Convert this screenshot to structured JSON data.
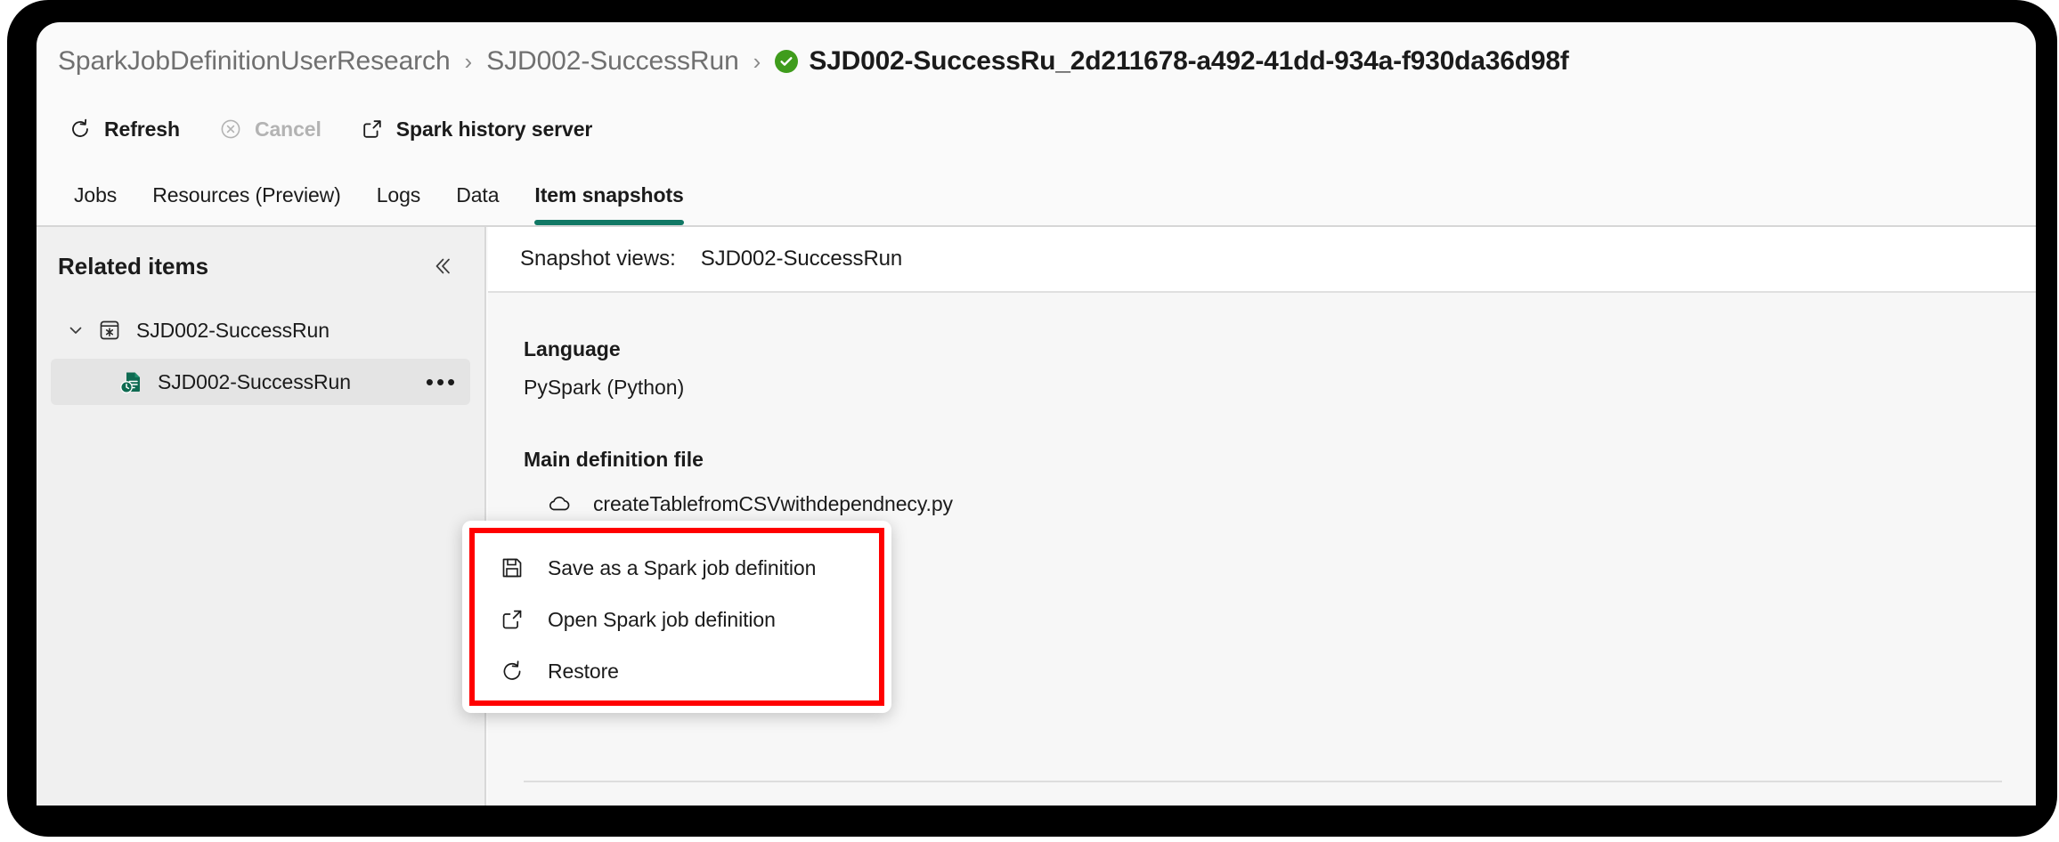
{
  "breadcrumb": {
    "items": [
      {
        "label": "SparkJobDefinitionUserResearch",
        "current": false
      },
      {
        "label": "SJD002-SuccessRun",
        "current": false
      },
      {
        "label": "SJD002-SuccessRu_2d211678-a492-41dd-934a-f930da36d98f",
        "current": true
      }
    ],
    "separator": "›",
    "status_icon": "success-check-icon",
    "status_color": "#3f9c1c"
  },
  "toolbar": {
    "refresh_label": "Refresh",
    "cancel_label": "Cancel",
    "spark_history_label": "Spark history server"
  },
  "tabs": [
    {
      "label": "Jobs",
      "active": false
    },
    {
      "label": "Resources (Preview)",
      "active": false
    },
    {
      "label": "Logs",
      "active": false
    },
    {
      "label": "Data",
      "active": false
    },
    {
      "label": "Item snapshots",
      "active": true
    }
  ],
  "tab_accent_color": "#117865",
  "sidebar": {
    "title": "Related items",
    "collapse_icon": "chevron-double-left-icon",
    "tree": [
      {
        "label": "SJD002-SuccessRun",
        "icon": "spark-job-definition-icon",
        "level": 0,
        "expanded": true,
        "selected": false
      },
      {
        "label": "SJD002-SuccessRun",
        "icon": "snapshot-document-icon",
        "level": 1,
        "expanded": false,
        "selected": true,
        "more_label": "•••"
      }
    ]
  },
  "content": {
    "snapshot_views_label": "Snapshot views:",
    "snapshot_views_value": "SJD002-SuccessRun",
    "fields": [
      {
        "label": "Language",
        "value": "PySpark (Python)"
      },
      {
        "label": "Main definition file",
        "value": ""
      }
    ],
    "main_file": {
      "name": "createTablefromCSVwithdependnecy.py",
      "icon": "cloud-icon"
    }
  },
  "context_menu": {
    "highlight_color": "#ff0000",
    "items": [
      {
        "label": "Save as a Spark job definition",
        "icon": "save-icon"
      },
      {
        "label": "Open Spark job definition",
        "icon": "open-external-icon"
      },
      {
        "label": "Restore",
        "icon": "restore-icon"
      }
    ]
  }
}
